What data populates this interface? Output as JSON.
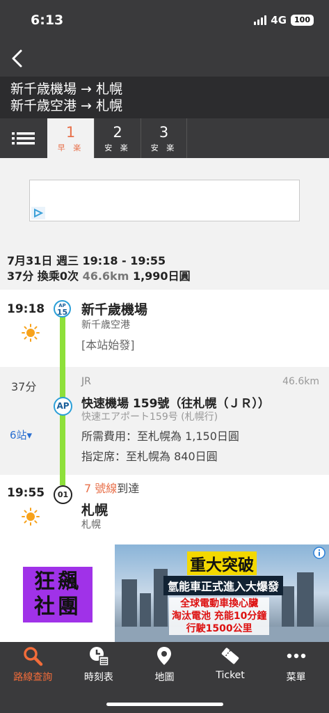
{
  "status": {
    "time": "6:13",
    "network": "4G",
    "battery": "100"
  },
  "route": {
    "line1": "新千歳機場 → 札幌",
    "line2": "新千歳空港 → 札幌"
  },
  "tabs": [
    {
      "num": "1",
      "sub": "早 楽"
    },
    {
      "num": "2",
      "sub": "安 楽"
    },
    {
      "num": "3",
      "sub": "安 楽"
    }
  ],
  "summary": {
    "line1": "7月31日 週三 19:18 - 19:55",
    "duration": "37分",
    "transfers": "換乘0次",
    "distance": "46.6km",
    "fare": "1,990日圓"
  },
  "departure": {
    "time": "19:18",
    "badge_top": "AP",
    "badge_num": "15",
    "name": "新千歲機場",
    "sub": "新千歳空港",
    "note": "[本站始發]"
  },
  "train": {
    "duration": "37分",
    "stops": "6站▾",
    "operator": "JR",
    "distance": "46.6km",
    "name": "快速機場 159號（往札幌（ＪＲ））",
    "sub": "快速エアポート159号 (札幌行)",
    "badge": "AP",
    "fare1": "所需費用：至札幌為 1,150日圓",
    "fare2": "指定席：至札幌為 840日圓"
  },
  "arrival": {
    "time": "19:55",
    "badge": "01",
    "line": "7 號線",
    "line_suffix": "到達",
    "name": "札幌",
    "sub": "札幌"
  },
  "ad": {
    "left_line1": "狂飆",
    "left_line2": "社團",
    "headline": "重大突破",
    "line2": "氫能車正式進入大爆發",
    "line3": "全球電動車換心臟",
    "line4": "淘汰電池 充能10分鐘",
    "line5": "行駛1500公里"
  },
  "nav": [
    {
      "label": "路線查詢",
      "icon": "search-icon"
    },
    {
      "label": "時刻表",
      "icon": "timetable-icon"
    },
    {
      "label": "地圖",
      "icon": "map-pin-icon"
    },
    {
      "label": "Ticket",
      "icon": "ticket-icon"
    },
    {
      "label": "菜單",
      "icon": "more-icon"
    }
  ],
  "colors": {
    "accent": "#e8704a",
    "line": "#8ee03a",
    "link": "#2a6fd0"
  }
}
